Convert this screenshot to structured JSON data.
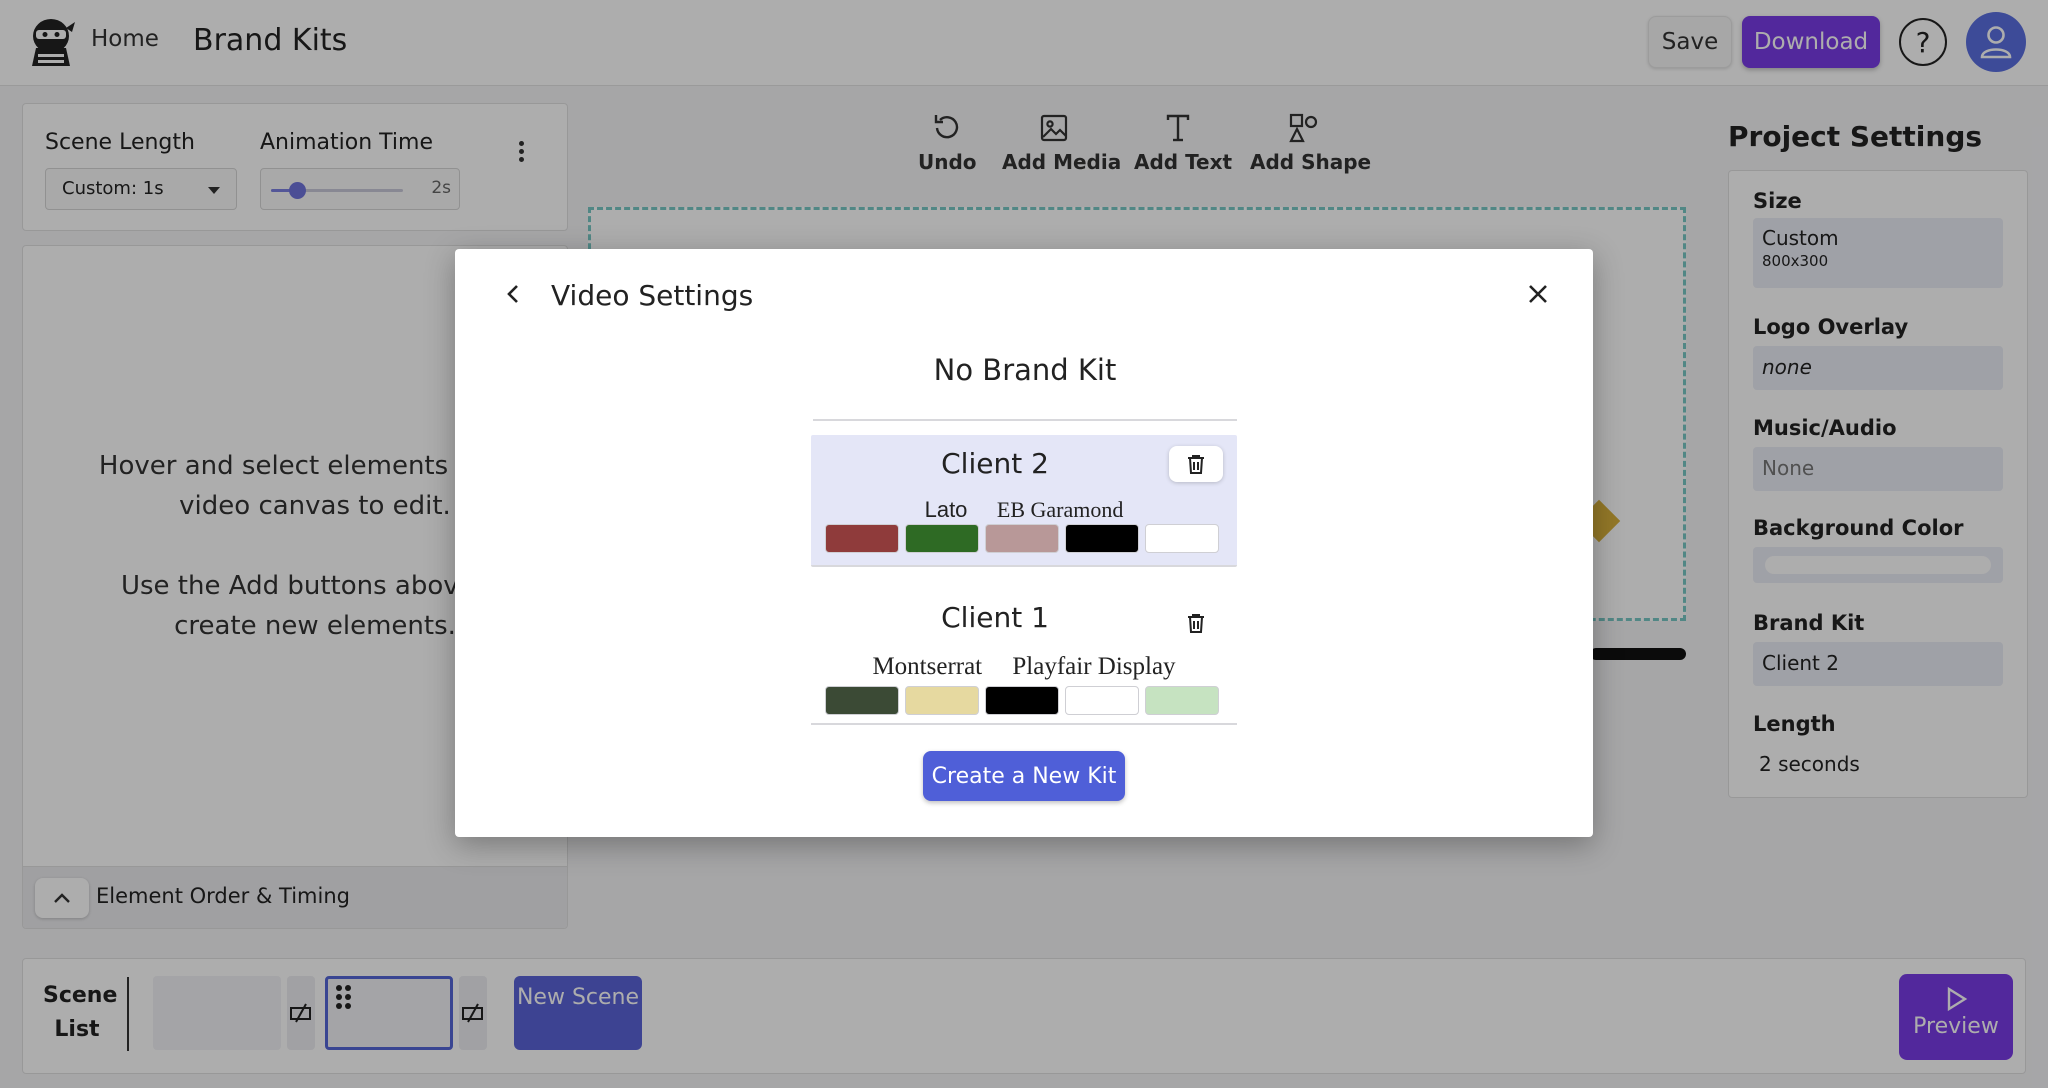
{
  "header": {
    "home_label": "Home",
    "title": "Brand Kits",
    "save_label": "Save",
    "download_label": "Download",
    "help_glyph": "?",
    "icons": {
      "logo": "ninja-logo",
      "help": "help-icon",
      "user": "user-icon"
    }
  },
  "scene_controls": {
    "scene_length_label": "Scene Length",
    "scene_length_value": "Custom: 1s",
    "animation_time_label": "Animation Time",
    "animation_time_value": "2s",
    "animation_slider_fraction": 0.2
  },
  "element_panel": {
    "hint_1": "Hover and select elements in the video canvas to edit.",
    "hint_2": "Use the Add buttons above to create new elements.",
    "order_label": "Element Order & Timing"
  },
  "toolbar": {
    "undo": "Undo",
    "add_media": "Add Media",
    "add_text": "Add Text",
    "add_shape": "Add Shape"
  },
  "project_settings": {
    "title": "Project Settings",
    "size_label": "Size",
    "size_value": "Custom",
    "size_sub": "800x300",
    "logo_label": "Logo Overlay",
    "logo_value": "none",
    "music_label": "Music/Audio",
    "music_value": "None",
    "bg_label": "Background Color",
    "bg_color": "#ffffff",
    "brand_kit_label": "Brand Kit",
    "brand_kit_value": "Client 2",
    "length_label": "Length",
    "length_value": "2 seconds"
  },
  "scene_list": {
    "label": "Scene List",
    "new_scene": "New Scene",
    "preview": "Preview"
  },
  "modal": {
    "title": "Video Settings",
    "no_brand_kit": "No Brand Kit",
    "create_label": "Create a New Kit",
    "kits": [
      {
        "name": "Client 2",
        "selected": true,
        "fonts": [
          "Lato",
          "EB Garamond"
        ],
        "colors": [
          "#8f3b3b",
          "#2e6a24",
          "#b89898",
          "#000000",
          "#ffffff"
        ]
      },
      {
        "name": "Client 1",
        "selected": false,
        "fonts": [
          "Montserrat",
          "Playfair Display"
        ],
        "colors": [
          "#3b4a35",
          "#e6d9a0",
          "#000000",
          "#ffffff",
          "#c6e3c1"
        ]
      }
    ]
  },
  "colors": {
    "accent_purple": "#7a3be6",
    "accent_blue": "#4f5fd8",
    "canvas_border": "#78c8c4"
  }
}
